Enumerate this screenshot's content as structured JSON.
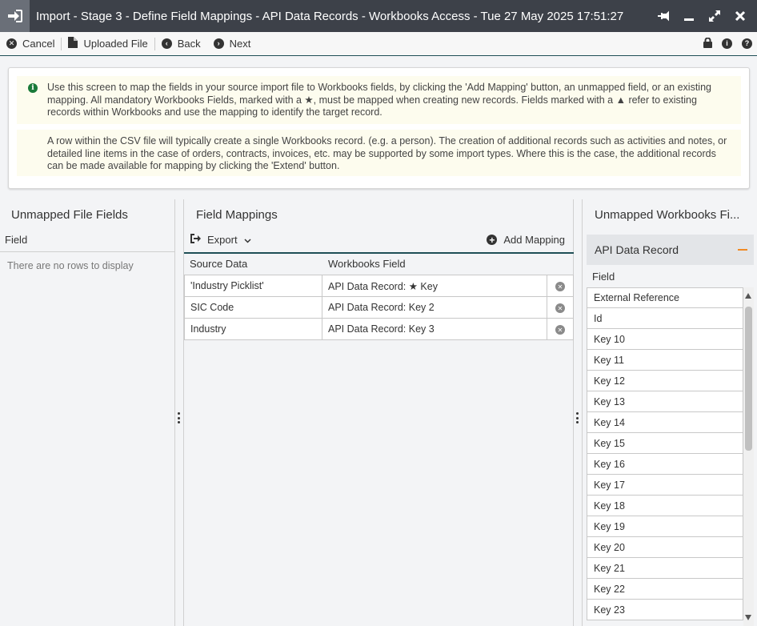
{
  "window": {
    "title": "Import - Stage 3 - Define Field Mappings - API Data Records - Workbooks Access - Tue 27 May 2025 17:51:27"
  },
  "toolbar": {
    "cancel_label": "Cancel",
    "uploaded_file_label": "Uploaded File",
    "back_label": "Back",
    "next_label": "Next"
  },
  "info": {
    "paragraph1": "Use this screen to map the fields in your source import file to Workbooks fields, by clicking the 'Add Mapping' button, an unmapped field, or an existing mapping. All mandatory Workbooks Fields, marked with a ★, must be mapped when creating new records. Fields marked with a ▲ refer to existing records within Workbooks and use the mapping to identify the target record.",
    "paragraph2": "A row within the CSV file will typically create a single Workbooks record. (e.g. a person). The creation of additional records such as activities and notes, or detailed line items in the case of orders, contracts, invoices, etc. may be supported by some import types. Where this is the case, the additional records can be made available for mapping by clicking the 'Extend' button."
  },
  "unmapped_file_fields": {
    "title": "Unmapped File Fields",
    "column_header": "Field",
    "empty_message": "There are no rows to display"
  },
  "field_mappings": {
    "title": "Field Mappings",
    "export_label": "Export",
    "add_mapping_label": "Add Mapping",
    "columns": [
      "Source Data",
      "Workbooks Field"
    ],
    "rows": [
      {
        "source": "'Industry Picklist'",
        "target": "API Data Record: ★ Key"
      },
      {
        "source": "SIC Code",
        "target": "API Data Record: Key 2"
      },
      {
        "source": "Industry",
        "target": "API Data Record: Key 3"
      }
    ]
  },
  "unmapped_workbooks_fields": {
    "title": "Unmapped Workbooks Fi...",
    "group_label": "API Data Record",
    "column_header": "Field",
    "fields": [
      "External Reference",
      "Id",
      "Key 10",
      "Key 11",
      "Key 12",
      "Key 13",
      "Key 14",
      "Key 15",
      "Key 16",
      "Key 17",
      "Key 18",
      "Key 19",
      "Key 20",
      "Key 21",
      "Key 22",
      "Key 23"
    ]
  },
  "colors": {
    "titlebar": "#3d4149",
    "accent_rule": "#1f4f56",
    "info_background": "#fdfcee",
    "collapse_icon": "#f08a24"
  }
}
